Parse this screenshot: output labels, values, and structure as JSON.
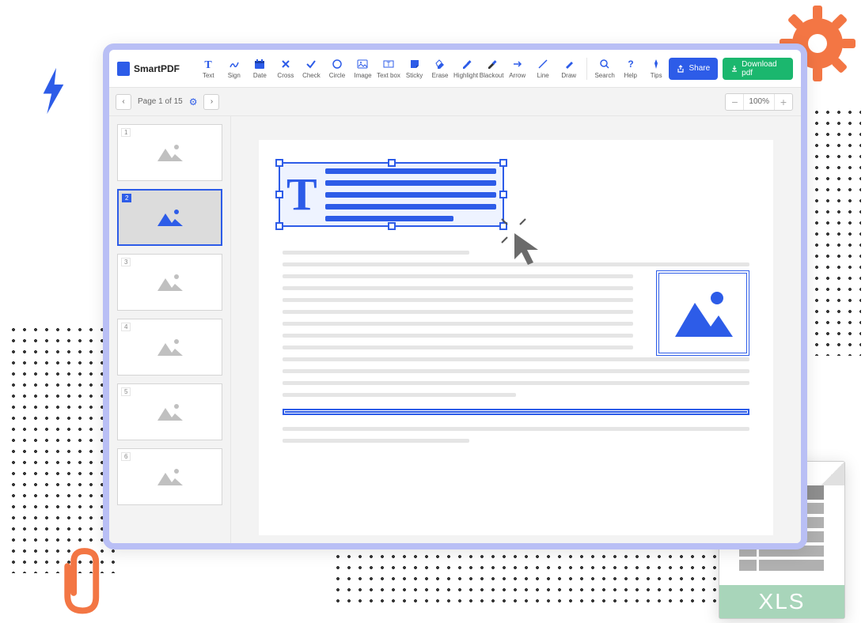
{
  "app": {
    "name": "SmartPDF"
  },
  "toolbar": {
    "tools": [
      {
        "id": "text",
        "label": "Text"
      },
      {
        "id": "sign",
        "label": "Sign"
      },
      {
        "id": "date",
        "label": "Date"
      },
      {
        "id": "cross",
        "label": "Cross"
      },
      {
        "id": "check",
        "label": "Check"
      },
      {
        "id": "circle",
        "label": "Circle"
      },
      {
        "id": "image",
        "label": "Image"
      },
      {
        "id": "textbox",
        "label": "Text box"
      },
      {
        "id": "sticky",
        "label": "Sticky"
      },
      {
        "id": "erase",
        "label": "Erase"
      },
      {
        "id": "highlight",
        "label": "Highlight"
      },
      {
        "id": "blackout",
        "label": "Blackout"
      },
      {
        "id": "arrow",
        "label": "Arrow"
      },
      {
        "id": "line",
        "label": "Line"
      },
      {
        "id": "draw",
        "label": "Draw"
      }
    ],
    "utilities": [
      {
        "id": "search",
        "label": "Search"
      },
      {
        "id": "help",
        "label": "Help"
      },
      {
        "id": "tips",
        "label": "Tips"
      }
    ],
    "share_label": "Share",
    "download_label": "Download pdf"
  },
  "pagenav": {
    "info": "Page 1 of 15",
    "zoom": "100%"
  },
  "thumbnails": [
    {
      "num": "1",
      "active": false
    },
    {
      "num": "2",
      "active": true
    },
    {
      "num": "3",
      "active": false
    },
    {
      "num": "4",
      "active": false
    },
    {
      "num": "5",
      "active": false
    },
    {
      "num": "6",
      "active": false
    }
  ],
  "file_badge": {
    "label": "XLS"
  }
}
